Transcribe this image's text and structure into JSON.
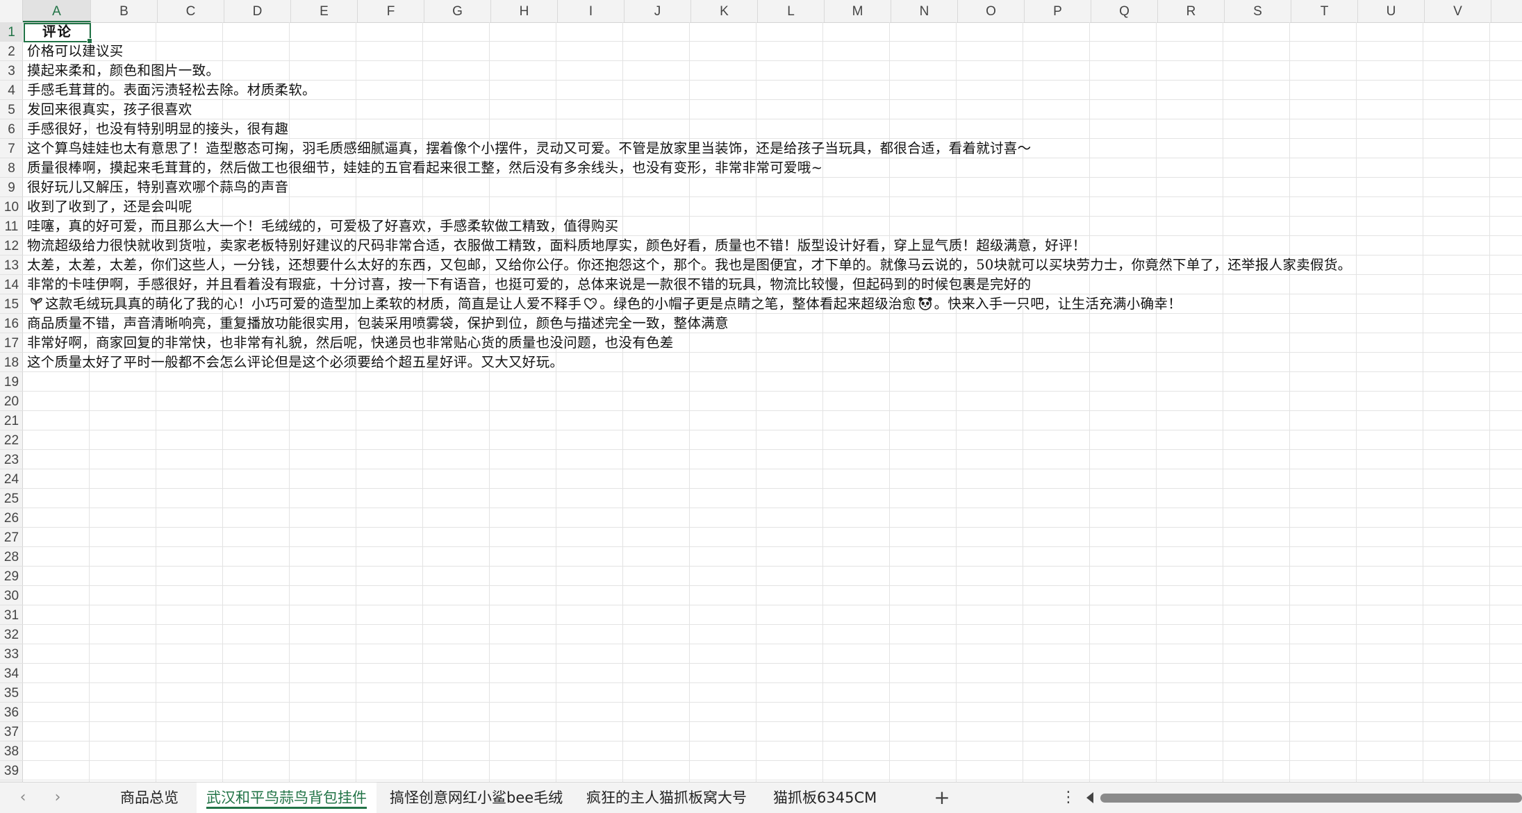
{
  "columns": [
    "A",
    "B",
    "C",
    "D",
    "E",
    "F",
    "G",
    "H",
    "I",
    "J",
    "K",
    "L",
    "M",
    "N",
    "O",
    "P",
    "Q",
    "R",
    "S",
    "T",
    "U",
    "V"
  ],
  "active_column": "A",
  "active_row": 1,
  "row_count": 39,
  "cells": [
    "评论",
    "价格可以建议买",
    "摸起来柔和，颜色和图片一致。",
    "手感毛茸茸的。表面污渍轻松去除。材质柔软。",
    "发回来很真实，孩子很喜欢",
    "手感很好，也没有特别明显的接头，很有趣",
    "这个算鸟娃娃也太有意思了！造型憨态可掬，羽毛质感细腻逼真，摆着像个小摆件，灵动又可爱。不管是放家里当装饰，还是给孩子当玩具，都很合适，看着就讨喜～",
    "质量很棒啊，摸起来毛茸茸的，然后做工也很细节，娃娃的五官看起来很工整，然后没有多余线头，也没有变形，非常非常可爱哦~",
    "很好玩儿又解压，特别喜欢哪个蒜鸟的声音",
    "收到了收到了，还是会叫呢",
    "哇噻，真的好可爱，而且那么大一个！毛绒绒的，可爱极了好喜欢，手感柔软做工精致，值得购买",
    "物流超级给力很快就收到货啦，卖家老板特别好建议的尺码非常合适，衣服做工精致，面料质地厚实，颜色好看，质量也不错！版型设计好看，穿上显气质！超级满意，好评！",
    "太差，太差，太差，你们这些人，一分钱，还想要什么太好的东西，又包邮，又给你公仔。你还抱怨这个，那个。我也是图便宜，才下单的。就像马云说的，50块就可以买块劳力士，你竟然下单了，还举报人家卖假货。",
    "非常的卡哇伊啊，手感很好，并且看着没有瑕疵，十分讨喜，按一下有语音，也挺可爱的，总体来说是一款很不错的玩具，物流比较慢，但起码到的时候包裹是完好的",
    {
      "prefix_icon": "seedling-icon",
      "part1": "这款毛绒玩具真的萌化了我的心！小巧可爱的造型加上柔软的材质，简直是让人爱不释手",
      "icon1": "heart-outline-icon",
      "part2": "。绿色的小帽子更是点睛之笔，整体看起来超级治愈",
      "icon2": "panda-face-icon",
      "part3": "。快来入手一只吧，让生活充满小确幸！"
    },
    "商品质量不错，声音清晰响亮，重复播放功能很实用，包装采用喷雾袋，保护到位，颜色与描述完全一致，整体满意",
    "非常好啊，商家回复的非常快，也非常有礼貌，然后呢，快递员也非常贴心货的质量也没问题，也没有色差",
    "这个质量太好了平时一般都不会怎么评论但是这个必须要给个超五星好评。又大又好玩。"
  ],
  "sheet_tabs": [
    "商品总览",
    "武汉和平鸟蒜鸟背包挂件",
    "搞怪创意网红小鲨bee毛绒",
    "疯狂的主人猫抓板窝大号",
    "猫抓板6345CM"
  ],
  "active_tab_index": 1,
  "colors": {
    "accent": "#217346",
    "grid_line": "#e3e3e3",
    "header_bg": "#f3f3f3"
  }
}
